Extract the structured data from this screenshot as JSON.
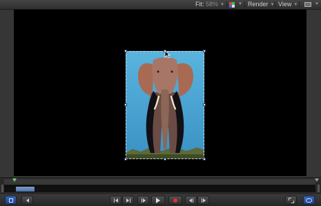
{
  "toolbar": {
    "fit_label": "Fit:",
    "fit_value": "58%",
    "color_icon": "color-channels-icon",
    "render_label": "Render",
    "view_label": "View",
    "layout_icon": "view-layout-icon"
  },
  "canvas": {
    "image": "elephant-photo",
    "image_selected": true
  },
  "timeline": {
    "playhead_icon": "playhead-marker",
    "clip_selected": true
  },
  "transport": {
    "buttons": [
      {
        "name": "play-range-button",
        "icon": "play-range-icon"
      },
      {
        "name": "previous-frame-button",
        "icon": "arrow-left-icon"
      },
      {
        "name": "go-to-start-button",
        "icon": "go-to-start-icon"
      },
      {
        "name": "go-to-end-button",
        "icon": "go-to-end-icon"
      },
      {
        "name": "step-button",
        "icon": "step-icon"
      },
      {
        "name": "play-button",
        "icon": "play-icon"
      },
      {
        "name": "record-button",
        "icon": "record-icon"
      },
      {
        "name": "previous-keyframe-button",
        "icon": "previous-keyframe-icon"
      },
      {
        "name": "next-keyframe-button",
        "icon": "next-keyframe-icon"
      },
      {
        "name": "full-screen-button",
        "icon": "expand-icon"
      },
      {
        "name": "loop-button",
        "icon": "loop-icon"
      }
    ]
  },
  "colors": {
    "canvas_bg": "#000000",
    "panel_bg": "#3a3a3a",
    "accent_blue": "#3a66b8",
    "record_red": "#e03030",
    "playhead_green": "#6bd06b",
    "sky_blue": "#4aa6d4"
  }
}
